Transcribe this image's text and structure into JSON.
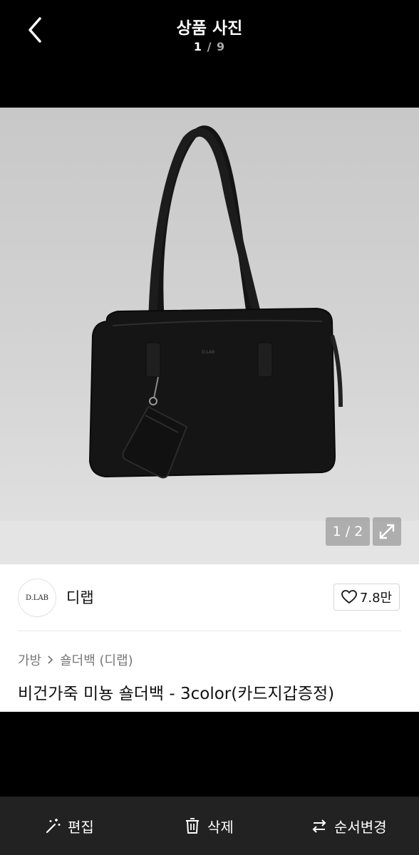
{
  "header": {
    "title": "상품 사진",
    "counter_current": "1",
    "counter_separator": "/",
    "counter_total": "9"
  },
  "photo": {
    "image_counter": "1 / 2",
    "brand_stamp": "D.LAB"
  },
  "shop": {
    "logo_text": "D.LAB",
    "name": "디랩",
    "likes": "7.8만"
  },
  "product": {
    "breadcrumb": [
      "가방",
      "숄더백 (디랩)"
    ],
    "title": "비건가죽 미뇽 숄더백 - 3color(카드지갑증정)"
  },
  "toolbar": {
    "edit_label": "편집",
    "delete_label": "삭제",
    "reorder_label": "순서변경"
  },
  "colors": {
    "header_bg": "#000000",
    "toolbar_bg": "#222222",
    "photo_bg": "#d2d2d2"
  }
}
